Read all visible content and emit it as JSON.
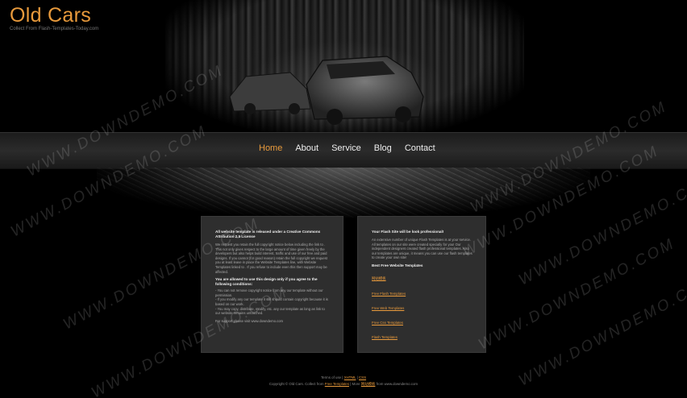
{
  "brand": {
    "title": "Old Cars",
    "tagline": "Collect From Flash-Templates-Today.com"
  },
  "nav": {
    "items": [
      {
        "label": "Home",
        "active": true
      },
      {
        "label": "About"
      },
      {
        "label": "Service"
      },
      {
        "label": "Blog"
      },
      {
        "label": "Contact"
      }
    ]
  },
  "left_box": {
    "heading": "All website template is released under a Creative Commons Attribution 2.5 License",
    "p1": "We request you retain the full copyright notice below including the link to . This not only gives respect to the large amount of time given freely by the developers but also helps build interest, traffic and use of our free and paid designs. If you cannot (for good reason) retain the full copyright we request you at least leave in place the Website Templates line, with Website Templates linked to . If you refuse to include even this then support may be affected.",
    "heading2": "You are allowed to use this design only if you agree to the following conditions:",
    "p2": "- You can not remove copyright notice from any our template without our permission.\n- If you modify any our template it still should contain copyright because it is based on our work.\n- You may copy, distribute, modify, etc. any our template as long as link to our website remains untouched.",
    "p3": "For support please visit www.downdemo.com"
  },
  "right_box": {
    "heading": "Your Flash Site will be look professional!",
    "p1": "An extensive number of unique Flash Templates is at your service. All templates on our site were created specially for you! Our independent designers created flash professional templates. Also our templates are unique, it means you can use our flash templates to create your own site!",
    "links_title": "Best Free Website Templates",
    "links": [
      "网站模板",
      "Free Flash Templates",
      "Free Web Templates",
      "Free Css Templates",
      "Flash Templates"
    ]
  },
  "footer": {
    "line1_prefix": "Terms of use |",
    "line1_link1": "XHTML",
    "line1_sep": "|",
    "line1_link2": "CSS",
    "line2_prefix": "Copyright © Old Cars. Collect from",
    "line2_link1": "Free Templates",
    "line2_mid": "| More",
    "line2_link2": "网站模板",
    "line2_suffix": "from www.downdemo.com"
  },
  "watermark": "WWW.DOWNDEMO.COM",
  "colors": {
    "accent": "#e89a3c",
    "background": "#000000",
    "box": "#2e2e2e"
  }
}
